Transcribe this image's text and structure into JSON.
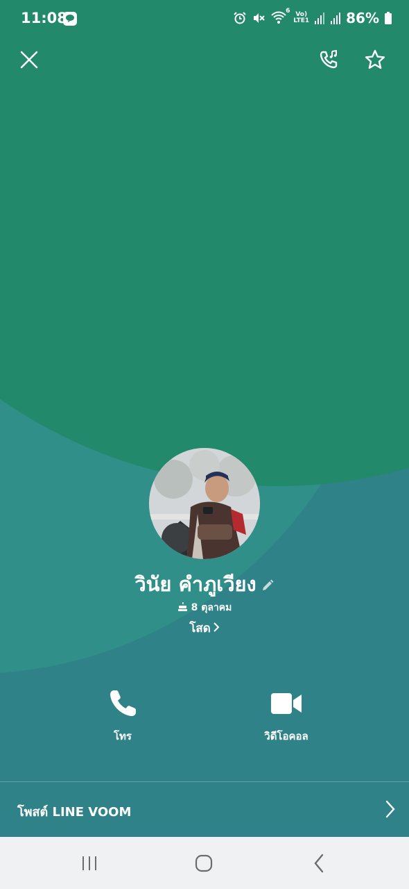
{
  "status_bar": {
    "time": "11:08",
    "battery": "86%",
    "icons": [
      "line-app-icon",
      "alarm-icon",
      "mute-icon",
      "wifi-icon",
      "volte-icon",
      "signal-icon",
      "signal-icon",
      "battery-icon"
    ],
    "wifi_badge": "6",
    "volte_label_top": "Vo)",
    "volte_label_bottom": "LTE1"
  },
  "header": {
    "icons": [
      "close-icon",
      "ringtone-icon",
      "star-icon"
    ]
  },
  "profile": {
    "name": "วินัย คำภูเวียง",
    "birthday": "8 ตุลาคม",
    "status_message": "โสด"
  },
  "actions": {
    "call_label": "โทร",
    "video_label": "วิดีโอคอล"
  },
  "voom": {
    "label": "โพสต์ LINE VOOM"
  },
  "nav": {
    "icons": [
      "recents-icon",
      "home-icon",
      "back-icon"
    ]
  },
  "colors": {
    "top_green": "#22896a",
    "mid_teal": "#308f88",
    "base_teal": "#2f8388",
    "nav_bg": "#f0f1f3"
  }
}
